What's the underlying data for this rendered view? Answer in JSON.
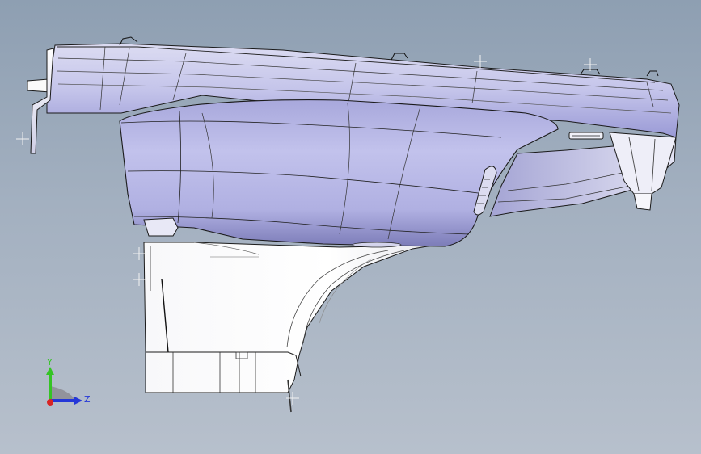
{
  "viewport": {
    "background_top": "#8e9fb2",
    "background_bottom": "#b7c0cc",
    "model": {
      "surface_color": "#b8b8e6",
      "edge_color": "#1a1a1a",
      "body_color": "#f4f4f6"
    }
  },
  "triad": {
    "y_label": "Y",
    "z_label": "Z",
    "y_color": "#34c424",
    "z_color": "#2437d8",
    "x_color": "#d82424",
    "icon": "coordinate-triad-icon"
  }
}
